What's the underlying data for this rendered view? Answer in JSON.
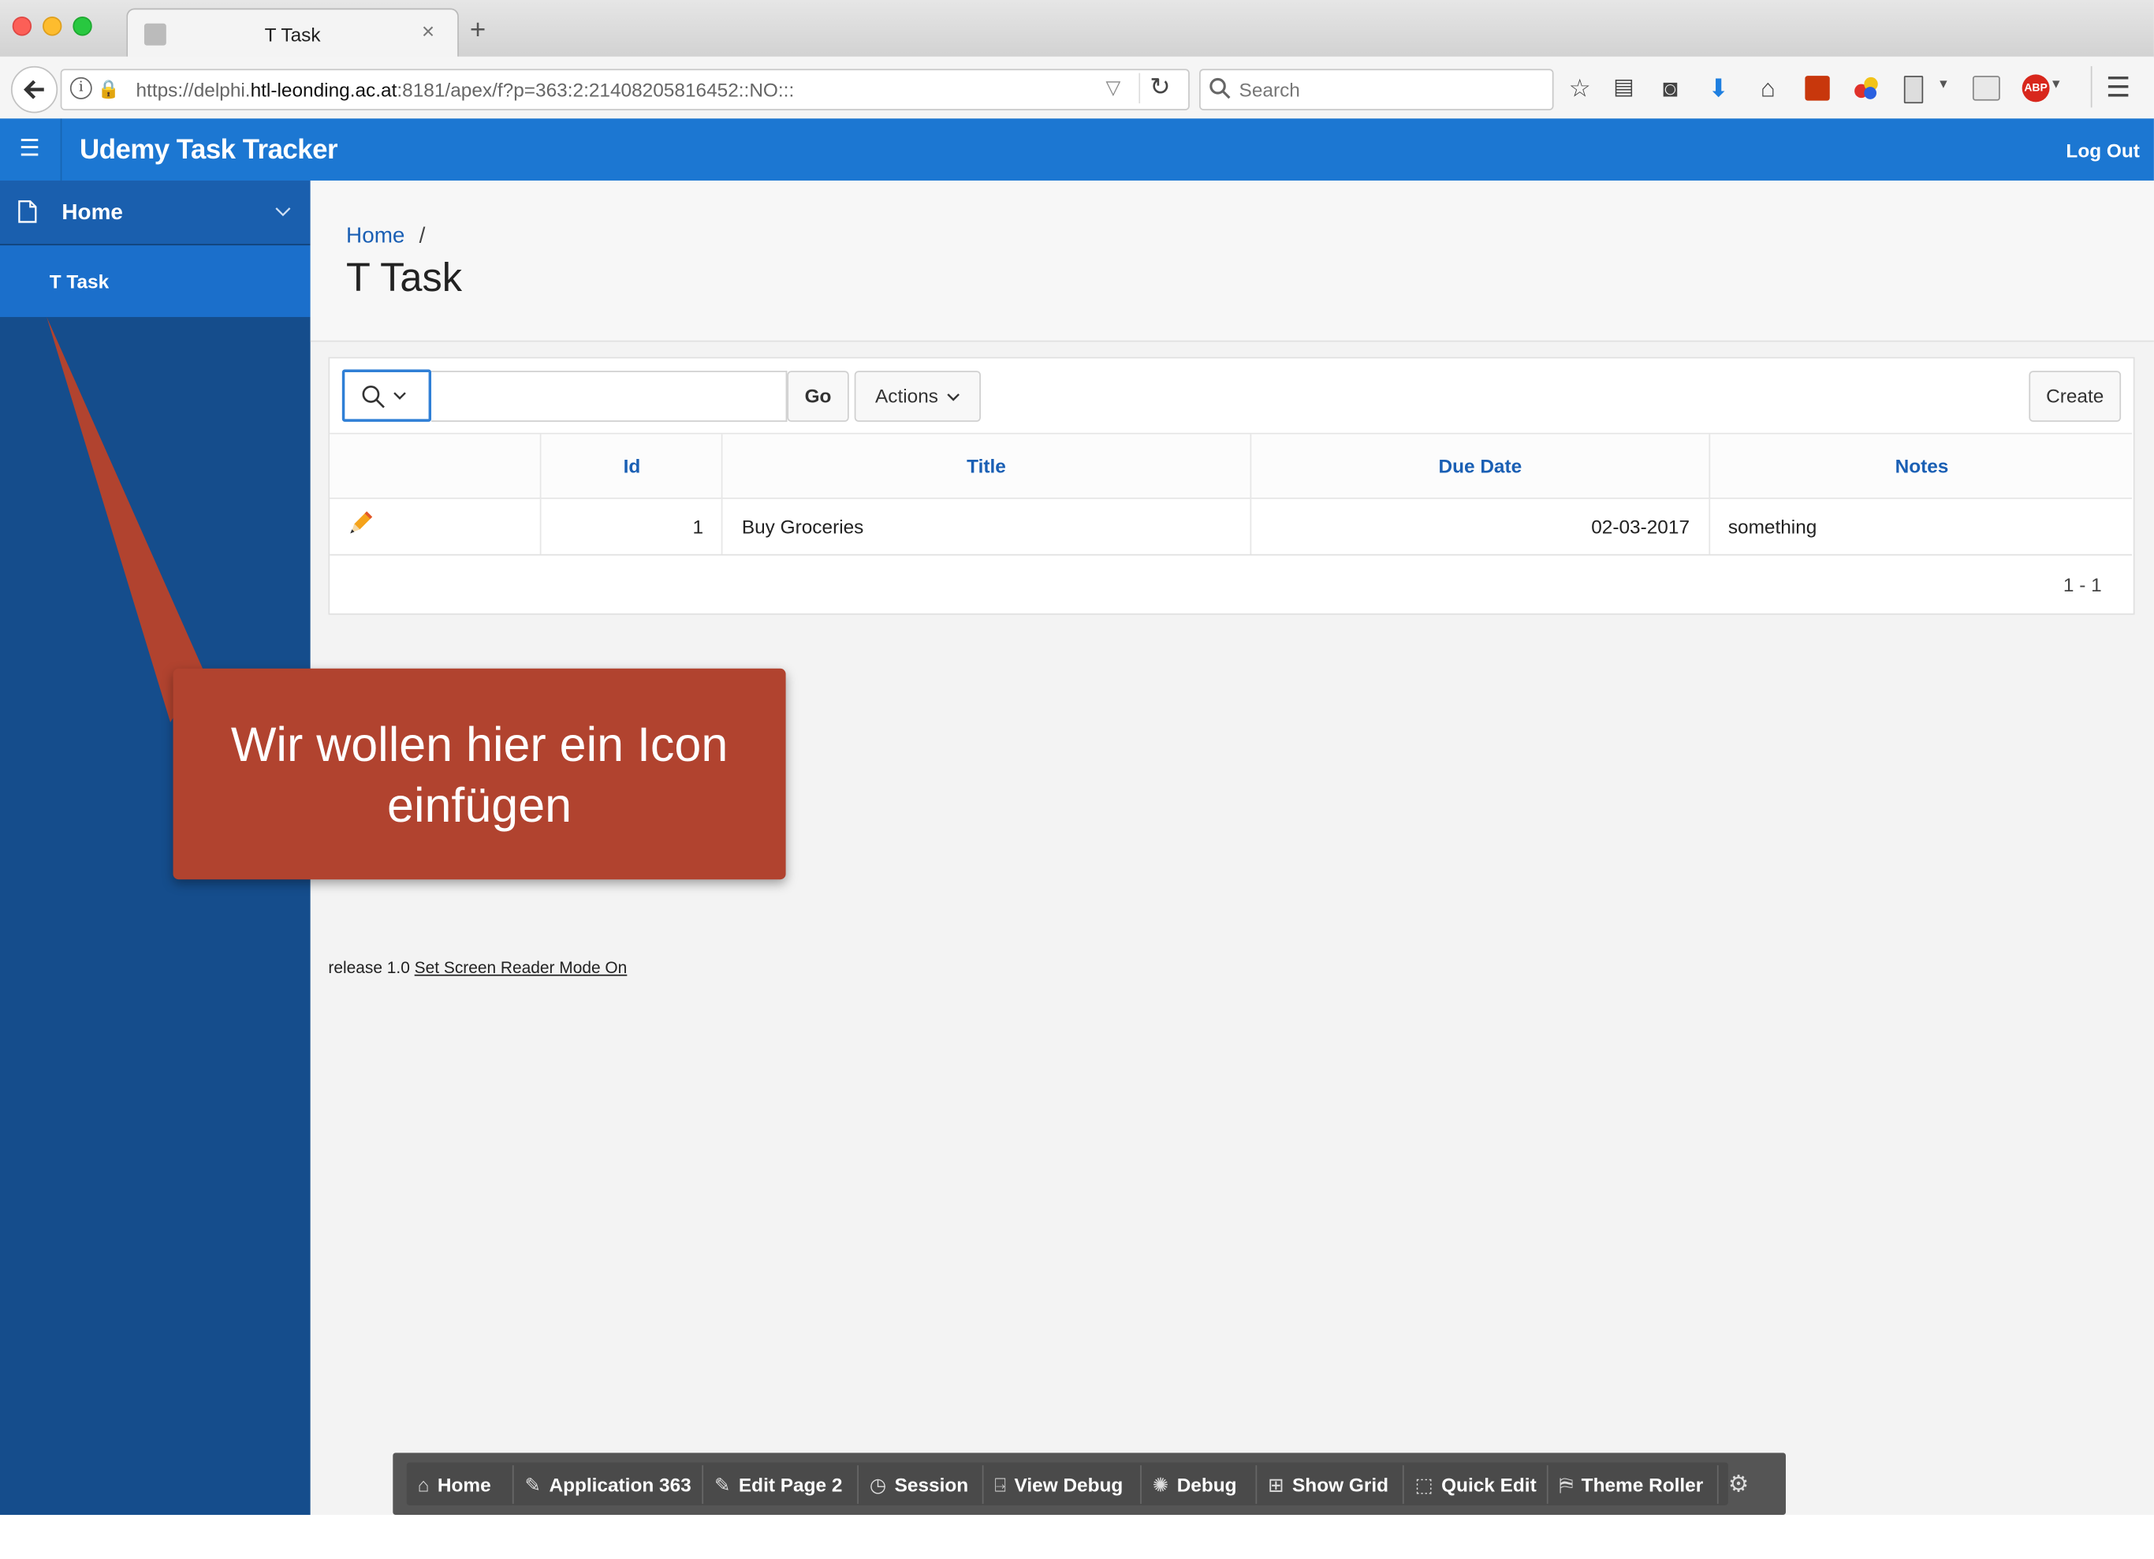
{
  "browser": {
    "tab_title": "T Task",
    "url_prefix": "https://delphi.",
    "url_domain": "htl-leonding.ac.at",
    "url_rest": ":8181/apex/f?p=363:2:21408205816452::NO:::",
    "search_placeholder": "Search",
    "new_tab": "+",
    "close_tab": "×"
  },
  "header": {
    "app_title": "Udemy Task Tracker",
    "logout_label": "Log Out",
    "menu_icon": "☰"
  },
  "sidebar": {
    "items": [
      {
        "label": "Home"
      },
      {
        "label": "T Task"
      }
    ]
  },
  "page": {
    "breadcrumb": "Home",
    "breadcrumb_sep": "/",
    "title": "T Task"
  },
  "report": {
    "go_label": "Go",
    "actions_label": "Actions",
    "create_label": "Create",
    "columns": [
      "Id",
      "Title",
      "Due Date",
      "Notes"
    ],
    "rows": [
      {
        "id": "1",
        "title": "Buy Groceries",
        "due_date": "02-03-2017",
        "notes": "something"
      }
    ],
    "pagination": "1 - 1"
  },
  "footer": {
    "release": "release 1.0",
    "screen_reader_link": "Set Screen Reader Mode On"
  },
  "devbar": {
    "items": [
      "Home",
      "Application 363",
      "Edit Page 2",
      "Session",
      "View Debug",
      "Debug",
      "Show Grid",
      "Quick Edit",
      "Theme Roller"
    ]
  },
  "callout": {
    "line1": "Wir wollen hier ein Icon",
    "line2": "einfügen"
  },
  "colors": {
    "header_blue": "#1c77d2",
    "sidebar_blue": "#154d8c",
    "link_blue": "#1a5fb4",
    "callout_red": "#b1432f"
  }
}
